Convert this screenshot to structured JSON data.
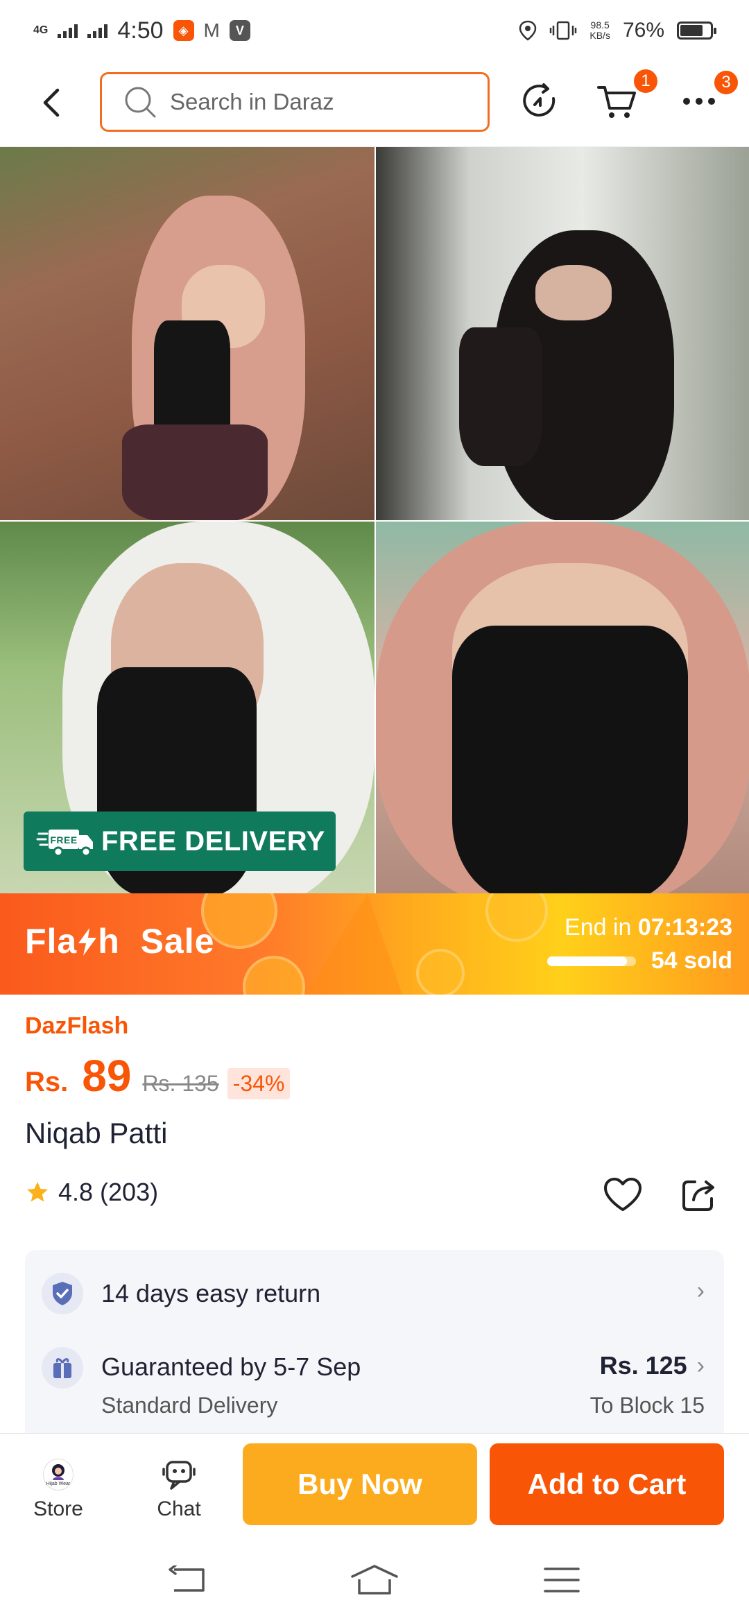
{
  "status_bar": {
    "network": "4G",
    "time": "4:50",
    "speed_value": "98.5",
    "speed_unit": "KB/s",
    "battery": "76%",
    "battery_level": 0.76,
    "app_icons": [
      "daraz-app-icon",
      "gmail-icon",
      "vidmate-icon"
    ]
  },
  "header": {
    "search_placeholder": "Search in Daraz",
    "cart_badge": "1",
    "more_badge": "3"
  },
  "gallery": {
    "badge_text": "FREE DELIVERY",
    "truck_label": "FREE"
  },
  "flash_sale": {
    "title_left": "Fla",
    "title_right": "h  Sale",
    "end_label": "End in",
    "countdown": "07:13:23",
    "sold": "54 sold",
    "sold_progress": 0.9
  },
  "product": {
    "promo_label": "DazFlash",
    "currency": "Rs.",
    "price": "89",
    "original_price": "Rs. 135",
    "discount": "-34%",
    "title": "Niqab Patti",
    "rating": "4.8 (203)"
  },
  "services": {
    "return_text": "14 days easy return",
    "delivery_text": "Guaranteed by 5-7 Sep",
    "delivery_sub": "Standard Delivery",
    "delivery_price": "Rs. 125",
    "delivery_to": "To Block 15"
  },
  "bottom_bar": {
    "store_label": "Store",
    "chat_label": "Chat",
    "buy_now": "Buy Now",
    "add_to_cart": "Add to Cart",
    "store_logo_text": "Hijab Wear"
  },
  "colors": {
    "brand": "#f85606",
    "buy_now": "#fdab1e",
    "free_delivery": "#0f7a5c"
  }
}
